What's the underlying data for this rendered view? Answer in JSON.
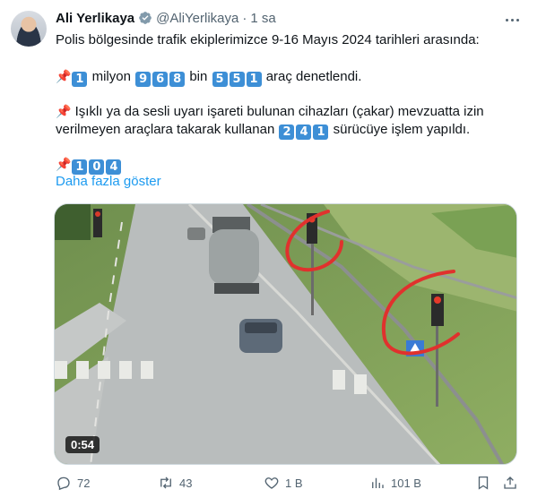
{
  "author": {
    "name": "Ali Yerlikaya",
    "handle": "@AliYerlikaya",
    "separator": "·",
    "time": "1 sa"
  },
  "tweet": {
    "line1": "Polis bölgesinde trafik ekiplerimizce 9-16 Mayıs 2024 tarihleri arasında:",
    "line2": {
      "pin": "📌",
      "n1": "1",
      "w1": "milyon",
      "n2": [
        "9",
        "6",
        "8"
      ],
      "w2": "bin",
      "n3": [
        "5",
        "5",
        "1"
      ],
      "w3": "araç denetlendi."
    },
    "line3": {
      "pin": "📌",
      "text": "Işıklı ya da sesli uyarı işareti bulunan cihazları (çakar) mevzuatta izin"
    },
    "line4": {
      "text": "verilmeyen araçlara takarak kullanan",
      "n": [
        "2",
        "4",
        "1"
      ],
      "text2": "sürücüye işlem yapıldı."
    },
    "line5": {
      "pin": "📌",
      "n": [
        "1",
        "0",
        "4"
      ]
    },
    "show_more": "Daha fazla göster"
  },
  "video": {
    "duration": "0:54"
  },
  "actions": {
    "replies": "72",
    "reposts": "43",
    "likes": "1 B",
    "views": "101 B"
  },
  "colors": {
    "link": "#1d9bf0",
    "muted": "#536471",
    "keycap": "#3d8fd6",
    "annotation": "#e0312d"
  },
  "icons": [
    "verified-badge-icon",
    "more-icon",
    "reply-icon",
    "repost-icon",
    "like-icon",
    "views-icon",
    "bookmark-icon",
    "share-icon"
  ]
}
